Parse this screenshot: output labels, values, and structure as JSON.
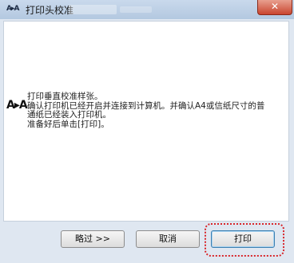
{
  "window": {
    "icon_text": "A▸A",
    "title": "打印头校准",
    "close_label": "✕"
  },
  "message": {
    "icon_text": "A▸A",
    "lines": [
      "打印垂直校准样张。",
      "确认打印机已经开启并连接到计算机。并确认A4或信纸尺寸的普",
      "通纸已经装入打印机。",
      "准备好后单击[打印]。"
    ]
  },
  "buttons": {
    "skip": "略过 >>",
    "cancel": "取消",
    "print": "打印"
  },
  "colors": {
    "highlight": "#d8262b",
    "close": "#c9452f"
  }
}
